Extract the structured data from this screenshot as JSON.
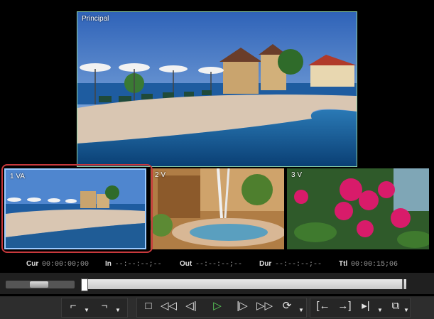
{
  "previews": {
    "main_label": "Principal",
    "thumbs": [
      {
        "label": "1 VA"
      },
      {
        "label": "2 V"
      },
      {
        "label": "3 V"
      }
    ]
  },
  "timecodes": {
    "cur_label": "Cur",
    "cur_value": "00:00:00;00",
    "in_label": "In",
    "in_value": "--:--:--;--",
    "out_label": "Out",
    "out_value": "--:--:--;--",
    "dur_label": "Dur",
    "dur_value": "--:--:--;--",
    "ttl_label": "Ttl",
    "ttl_value": "00:00:15;06"
  },
  "toolbar": {
    "icons": [
      "set-in-icon",
      "set-out-icon",
      "stop-icon",
      "rewind-icon",
      "step-back-icon",
      "play-icon",
      "step-forward-icon",
      "fast-forward-icon",
      "loop-icon",
      "go-in-icon",
      "go-out-icon",
      "play-in-out-icon",
      "match-frame-icon"
    ]
  }
}
